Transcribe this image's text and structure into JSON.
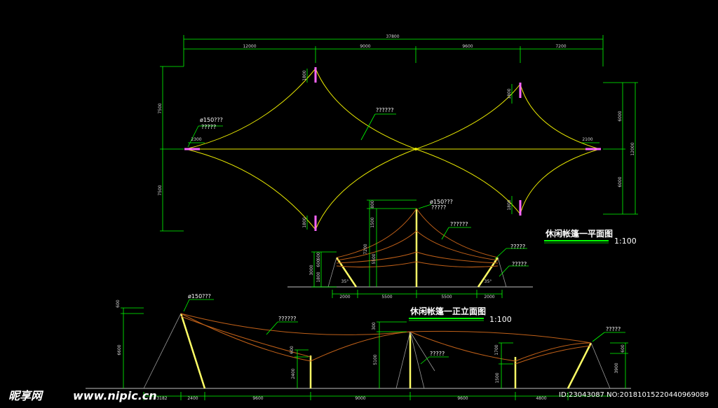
{
  "plan": {
    "title": "休闲帐篷一平面图",
    "scale": "1:100",
    "dims_top_total": "37800",
    "dims_top": [
      "12000",
      "9000",
      "9600",
      "7200"
    ],
    "dims_left": [
      "7500",
      "7500"
    ],
    "dims_right_total": "12000",
    "dims_right": [
      "6000",
      "6000"
    ],
    "mast_dims": [
      "1800",
      "1800",
      "1800",
      "1800"
    ],
    "left_anchor_dim": "2300",
    "right_anchor_dim": "2100",
    "callout_mast": "ø150???",
    "callout_mast_2": "?????",
    "callout_membrane": "??????"
  },
  "side_elevation": {
    "dims_left": [
      "3000",
      "1800",
      "600",
      "600"
    ],
    "dims_mid": [
      "800",
      "1500",
      "7200",
      "5500"
    ],
    "dims_bottom": [
      "2000",
      "5500",
      "5500",
      "2000"
    ],
    "callout_mast": "ø150???",
    "callout_mast_2": "?????",
    "callout_membrane": "??????",
    "callout_right_1": "?????",
    "callout_right_2": "?????",
    "angle_left": "35°",
    "angle_right": "35°"
  },
  "front_elevation": {
    "title": "休闲帐篷一正立面图",
    "scale": "1:100",
    "dims_bottom": [
      "3182",
      "2400",
      "9600",
      "9000",
      "9600",
      "4800"
    ],
    "dims_left": [
      "600",
      "6600"
    ],
    "dims_mast2": [
      "600",
      "2400"
    ],
    "dims_center": [
      "300",
      "5100"
    ],
    "dims_mast4": [
      "1700",
      "1500"
    ],
    "dims_right": [
      "600",
      "3900"
    ],
    "callout_mast": "ø150???",
    "callout_membrane": "??????",
    "callout_center": "?????",
    "callout_right": "?????"
  },
  "watermark": {
    "logo": "昵享网",
    "url": "www.nipic.cn",
    "id_text": "ID:23043087 NO:20181015220440969089"
  },
  "colors": {
    "dimension": "#00ff00",
    "membrane_plan": "#e8e800",
    "cable": "#c06018",
    "mast": "#ffff66",
    "anchor": "#ff66ff",
    "guy": "#9a9a9a",
    "ground": "#9a9a9a"
  }
}
